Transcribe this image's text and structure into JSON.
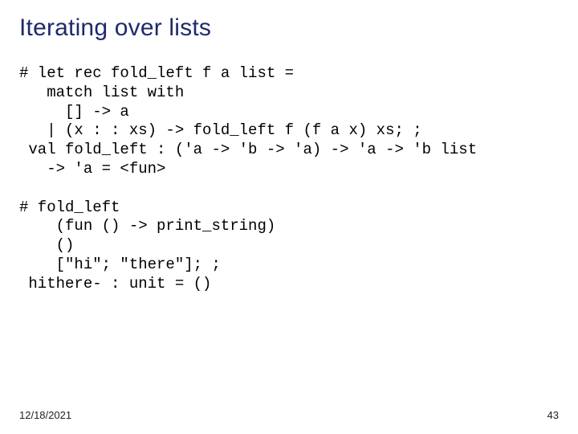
{
  "title": "Iterating over lists",
  "code1": "# let rec fold_left f a list =\n   match list with\n     [] -> a\n   | (x : : xs) -> fold_left f (f a x) xs; ;\n val fold_left : ('a -> 'b -> 'a) -> 'a -> 'b list\n   -> 'a = <fun>",
  "code2": "# fold_left\n    (fun () -> print_string)\n    ()\n    [\"hi\"; \"there\"]; ;\n hithere- : unit = ()",
  "footer": {
    "date": "12/18/2021",
    "page": "43"
  }
}
